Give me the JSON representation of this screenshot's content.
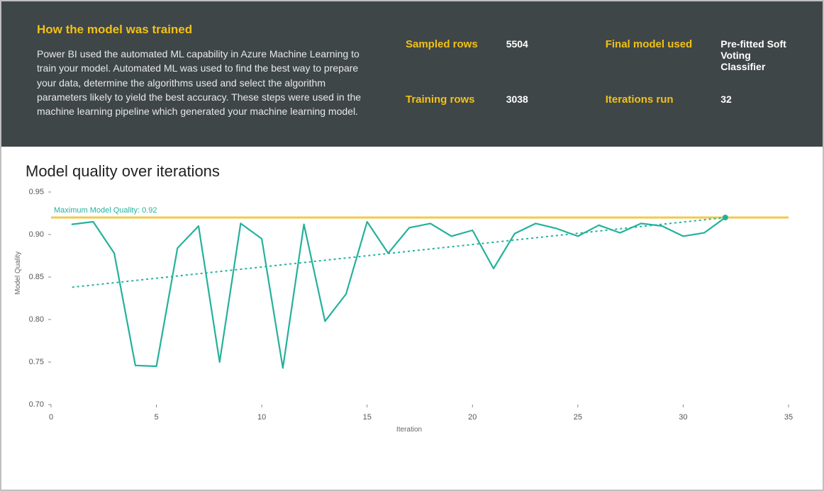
{
  "header": {
    "title": "How the model was trained",
    "description": "Power BI used the automated ML capability in Azure Machine Learning to train your model. Automated ML was used to find the best way to prepare your data, determine the algorithms used and select the algorithm parameters likely to yield the best accuracy. These steps were used in the machine learning pipeline which generated your machine learning model."
  },
  "stats": {
    "sampled_rows_label": "Sampled rows",
    "sampled_rows_value": "5504",
    "training_rows_label": "Training rows",
    "training_rows_value": "3038",
    "final_model_label": "Final model used",
    "final_model_value": "Pre-fitted Soft Voting Classifier",
    "iterations_label": "Iterations run",
    "iterations_value": "32"
  },
  "chart_data": {
    "type": "line",
    "title": "Model quality over iterations",
    "xlabel": "Iteration",
    "ylabel": "Model Quality",
    "xlim": [
      0,
      35
    ],
    "ylim": [
      0.7,
      0.95
    ],
    "yticks": [
      0.7,
      0.75,
      0.8,
      0.85,
      0.9,
      0.95
    ],
    "xticks": [
      0,
      5,
      10,
      15,
      20,
      25,
      30,
      35
    ],
    "max_line": {
      "value": 0.92,
      "label": "Maximum Model Quality: 0.92"
    },
    "trend": {
      "x": [
        1,
        32
      ],
      "y": [
        0.838,
        0.92
      ]
    },
    "series": [
      {
        "name": "Model Quality",
        "x": [
          1,
          2,
          3,
          4,
          5,
          6,
          7,
          8,
          9,
          10,
          11,
          12,
          13,
          14,
          15,
          16,
          17,
          18,
          19,
          20,
          21,
          22,
          23,
          24,
          25,
          26,
          27,
          28,
          29,
          30,
          31,
          32
        ],
        "y": [
          0.912,
          0.915,
          0.878,
          0.746,
          0.745,
          0.884,
          0.91,
          0.75,
          0.913,
          0.895,
          0.743,
          0.912,
          0.798,
          0.83,
          0.915,
          0.878,
          0.908,
          0.913,
          0.898,
          0.905,
          0.86,
          0.901,
          0.913,
          0.907,
          0.898,
          0.911,
          0.902,
          0.913,
          0.91,
          0.898,
          0.902,
          0.92
        ]
      }
    ]
  }
}
